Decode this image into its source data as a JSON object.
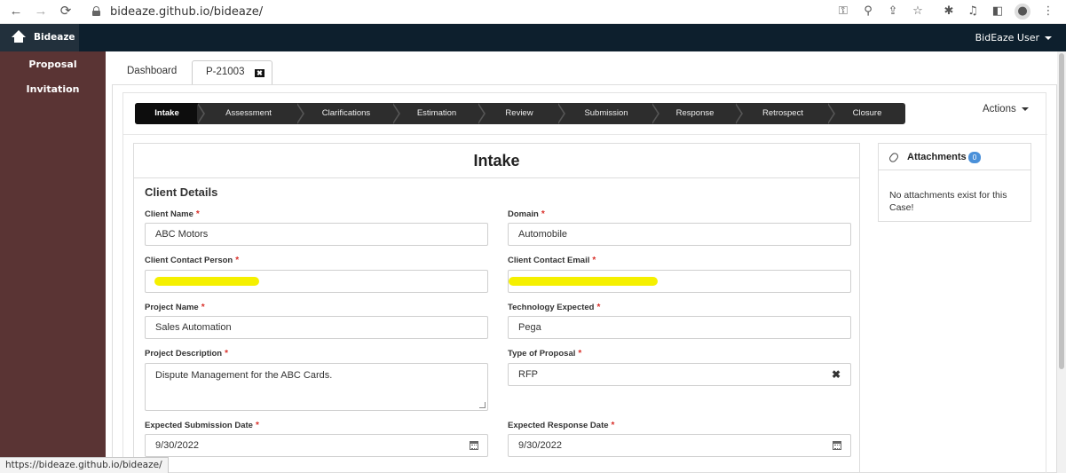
{
  "browser": {
    "url": "bideaze.github.io/bideaze/",
    "status_url": "https://bideaze.github.io/bideaze/",
    "nav": {
      "back": "←",
      "forward": "→",
      "reload": "⟳"
    },
    "toolbar_icons": [
      "key-icon",
      "zoom-icon",
      "share-icon",
      "bookmark-star-icon",
      "extensions-icon",
      "media-icon",
      "sidepanel-icon",
      "profile-icon",
      "menu-icon"
    ]
  },
  "navbar": {
    "brand": "Bideaze",
    "user": "BidEaze User"
  },
  "sidebar": {
    "items": [
      {
        "label": "Proposal"
      },
      {
        "label": "Invitation"
      }
    ]
  },
  "tabs": [
    {
      "label": "Dashboard"
    },
    {
      "label": "P-21003",
      "close": "✖"
    }
  ],
  "stepper": {
    "steps": [
      "Intake",
      "Assessment",
      "Clarifications",
      "Estimation",
      "Review",
      "Submission",
      "Response",
      "Retrospect",
      "Closure"
    ],
    "active": "Intake"
  },
  "actions_label": "Actions",
  "intake": {
    "title": "Intake",
    "section": "Client Details",
    "required_mark": "*",
    "fields": {
      "client_name": {
        "label": "Client Name",
        "value": "ABC Motors"
      },
      "domain": {
        "label": "Domain",
        "value": "Automobile"
      },
      "contact_person": {
        "label": "Client Contact Person",
        "value": ""
      },
      "contact_email": {
        "label": "Client Contact Email",
        "value": ""
      },
      "project_name": {
        "label": "Project Name",
        "value": "Sales Automation"
      },
      "technology": {
        "label": "Technology Expected",
        "value": "Pega"
      },
      "project_description": {
        "label": "Project Description",
        "value": "Dispute Management for the ABC Cards."
      },
      "proposal_type": {
        "label": "Type of Proposal",
        "value": "RFP",
        "clear": "✖"
      },
      "submission_date": {
        "label": "Expected Submission Date",
        "value": "9/30/2022"
      },
      "response_date": {
        "label": "Expected Response Date",
        "value": "9/30/2022"
      }
    }
  },
  "attachments": {
    "title": "Attachments",
    "count": "0",
    "empty_text": "No attachments exist for this Case!"
  },
  "colors": {
    "navbar": "#0d1f2d",
    "sidebar": "#5a3434",
    "stepper": "#2d2d2d",
    "badge": "#4a90d9",
    "redaction": "#f5f000",
    "required": "#d9302a"
  }
}
